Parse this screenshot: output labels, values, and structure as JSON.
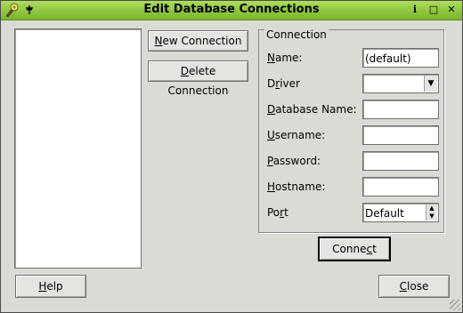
{
  "window": {
    "title": "Edit Database Connections",
    "controls": {
      "info": "i",
      "maximize": "□",
      "close": "✕"
    }
  },
  "buttons": {
    "new_connection": {
      "pre": "",
      "mnemonic": "N",
      "post": "ew Connection"
    },
    "delete_connection": {
      "pre": "",
      "mnemonic": "D",
      "post": "elete Connection"
    },
    "connect": {
      "pre": "Conne",
      "mnemonic": "c",
      "post": "t"
    },
    "help": {
      "pre": "",
      "mnemonic": "H",
      "post": "elp"
    },
    "close": {
      "pre": "",
      "mnemonic": "C",
      "post": "lose"
    }
  },
  "connection": {
    "legend": "Connection",
    "fields": {
      "name": {
        "label_pre": "",
        "label_mn": "N",
        "label_post": "ame:",
        "value": "(default)"
      },
      "driver": {
        "label_pre": "D",
        "label_mn": "r",
        "label_post": "iver",
        "value": ""
      },
      "database": {
        "label_pre": "",
        "label_mn": "D",
        "label_post": "atabase Name:",
        "value": ""
      },
      "username": {
        "label_pre": "",
        "label_mn": "U",
        "label_post": "sername:",
        "value": ""
      },
      "password": {
        "label_pre": "",
        "label_mn": "P",
        "label_post": "assword:",
        "value": ""
      },
      "hostname": {
        "label_pre": "",
        "label_mn": "H",
        "label_post": "ostname:",
        "value": ""
      },
      "port": {
        "label_pre": "Po",
        "label_mn": "r",
        "label_post": "t",
        "value": "Default"
      }
    }
  }
}
